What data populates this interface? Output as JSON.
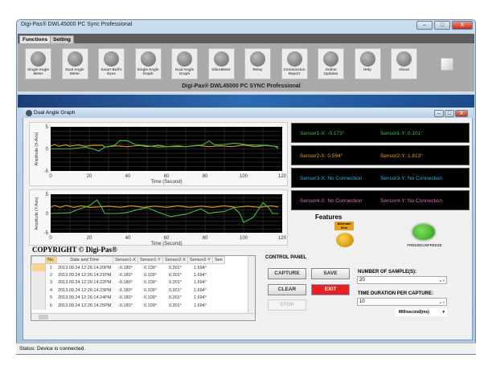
{
  "window": {
    "title": "Digi-Pas® DWL45000 PC Sync Professional",
    "minimize": "–",
    "maximize": "□",
    "close": "X"
  },
  "tabs": [
    "Functions",
    "Setting"
  ],
  "toolbar": {
    "items": [
      "Single Angle Meter",
      "Dual Angle Meter",
      "Smart Bull's Eyes",
      "Single Angle Graph",
      "Dual Angle Graph",
      "VibroMeter",
      "Relay",
      "Commission Report",
      "Online Updates",
      "Help",
      "About"
    ],
    "caption": "Digi-Pas® DWL45000 PC SYNC Professional"
  },
  "inner_window": {
    "title": "Dual Angle Graph"
  },
  "chart_data": [
    {
      "type": "line",
      "title": "",
      "xlabel": "Time (Second)",
      "ylabel": "Amplitude (X-Axis)",
      "xlim": [
        0,
        120
      ],
      "ylim": [
        -5,
        5
      ],
      "xticks": [
        0,
        20,
        40,
        60,
        80,
        100,
        120
      ],
      "yticks": [
        5,
        0,
        -5
      ],
      "grid": true,
      "series": [
        {
          "name": "Sensor1",
          "color": "#3fbf3f",
          "x": [
            0,
            10,
            18,
            22,
            25,
            28,
            33,
            36,
            40,
            44,
            50,
            56,
            60,
            70,
            78,
            80,
            82,
            85,
            90,
            95,
            98,
            102,
            110,
            116,
            118
          ],
          "y": [
            0,
            0,
            0.4,
            0,
            -0.5,
            0.4,
            0.8,
            1.9,
            1.8,
            1,
            0.7,
            0.4,
            0.5,
            0.5,
            0.8,
            1.2,
            1.8,
            0.9,
            1,
            1.3,
            1.2,
            0.9,
            0.8,
            0.6,
            0.1
          ]
        },
        {
          "name": "Sensor2",
          "color": "#e0a020",
          "x": [
            0,
            2,
            4,
            8,
            10,
            14,
            18,
            22,
            27,
            28,
            34,
            40,
            46,
            50,
            56,
            60,
            66,
            70,
            76,
            82,
            88,
            94,
            100,
            106,
            112,
            118
          ],
          "y": [
            0.6,
            1,
            0.6,
            0.9,
            0.6,
            0.9,
            0.6,
            0.8,
            0.8,
            0.4,
            0.7,
            0.5,
            0.8,
            0.5,
            0.8,
            0.5,
            0.7,
            0.5,
            0.8,
            0.5,
            0.7,
            0.5,
            0.9,
            0.5,
            0.8,
            0.5
          ]
        }
      ]
    },
    {
      "type": "line",
      "title": "",
      "xlabel": "Time (Second)",
      "ylabel": "Amplitude (Y-Axis)",
      "xlim": [
        0,
        120
      ],
      "ylim": [
        -5,
        5
      ],
      "xticks": [
        0,
        20,
        40,
        60,
        80,
        100,
        120
      ],
      "yticks": [
        5,
        0,
        -5
      ],
      "grid": true,
      "series": [
        {
          "name": "Sensor1",
          "color": "#3fbf3f",
          "x": [
            0,
            10,
            15,
            20,
            24,
            26,
            28,
            35,
            40,
            45,
            50,
            55,
            62,
            70,
            78,
            82,
            85,
            90,
            95,
            98,
            100,
            105,
            110,
            113,
            115,
            118
          ],
          "y": [
            0,
            0.2,
            1.2,
            2,
            3.5,
            2,
            0,
            0,
            0.3,
            1,
            1.5,
            0.5,
            -0.8,
            -0.2,
            1.2,
            0,
            0.3,
            0.5,
            1.5,
            0,
            -2.3,
            -1,
            2.8,
            1.5,
            0,
            0
          ]
        },
        {
          "name": "Sensor2",
          "color": "#e0a020",
          "x": [
            0,
            2,
            5,
            8,
            12,
            16,
            20,
            25,
            30,
            36,
            42,
            48,
            54,
            60,
            66,
            72,
            78,
            84,
            90,
            96,
            102,
            108,
            114,
            118
          ],
          "y": [
            1.6,
            2.1,
            1.6,
            2.1,
            1.6,
            2,
            1.6,
            1.7,
            1.9,
            1.6,
            2,
            1.6,
            1.9,
            1.6,
            2,
            1.6,
            1.9,
            1.6,
            2,
            1.6,
            1.9,
            1.6,
            2,
            1.7
          ]
        }
      ]
    }
  ],
  "sensors": [
    {
      "x": "Sensor1-X: -0.173°",
      "y": "Sensor1-Y: 0.101°",
      "color": "#3fbf3f"
    },
    {
      "x": "Sensor2-X: 0.594°",
      "y": "Sensor2-Y: 1.813°",
      "color": "#e0a020"
    },
    {
      "x": "Sensor3-X: No Connection",
      "y": "Sensor3-Y: No Connection",
      "color": "#3ab0d8"
    },
    {
      "x": "Sensor4-X: No Connection",
      "y": "Sensor4-Y: No Connection",
      "color": "#d070c0"
    }
  ],
  "features": {
    "title": "Features",
    "alternate": "Alternate Zero",
    "freeze": "FREEZE/UNFREEZE"
  },
  "copyright": "COPYRIGHT © Digi-Pas®",
  "table": {
    "columns": [
      "No.",
      "Date and Time",
      "Sensor1-X",
      "Sensor1-Y",
      "Sensor2-X",
      "Sensor2-Y",
      "Sen"
    ],
    "rows": [
      [
        "1",
        "2013.09.24 12:26:14.20PM",
        "-0.180°",
        "0.109°",
        "0.301°",
        "1.694°"
      ],
      [
        "2",
        "2013.09.24 12:26:14.21PM",
        "-0.180°",
        "0.109°",
        "0.301°",
        "1.694°"
      ],
      [
        "3",
        "2013.09.24 12:26:14.22PM",
        "-0.180°",
        "0.109°",
        "0.301°",
        "1.694°"
      ],
      [
        "4",
        "2013.09.24 12:26:14.23PM",
        "-0.180°",
        "0.109°",
        "0.301°",
        "1.694°"
      ],
      [
        "5",
        "2013.09.24 12:26:14.24PM",
        "-0.180°",
        "0.109°",
        "0.301°",
        "1.694°"
      ],
      [
        "6",
        "2013.09.24 12:26:14.25PM",
        "-0.180°",
        "0.109°",
        "0.301°",
        "1.694°"
      ]
    ]
  },
  "control_panel": {
    "title": "CONTROL PANEL",
    "capture": "CAPTURE",
    "save": "SAVE",
    "clear": "CLEAR",
    "exit": "EXIT",
    "stop": "STOP",
    "samples_label": "NUMBER OF SAMPLE(S):",
    "samples_value": "20",
    "duration_label": "TIME DURATION PER CAPTURE:",
    "duration_value": "10",
    "unit": "Millisecond(ms)"
  },
  "status": "Status: Device is connected."
}
